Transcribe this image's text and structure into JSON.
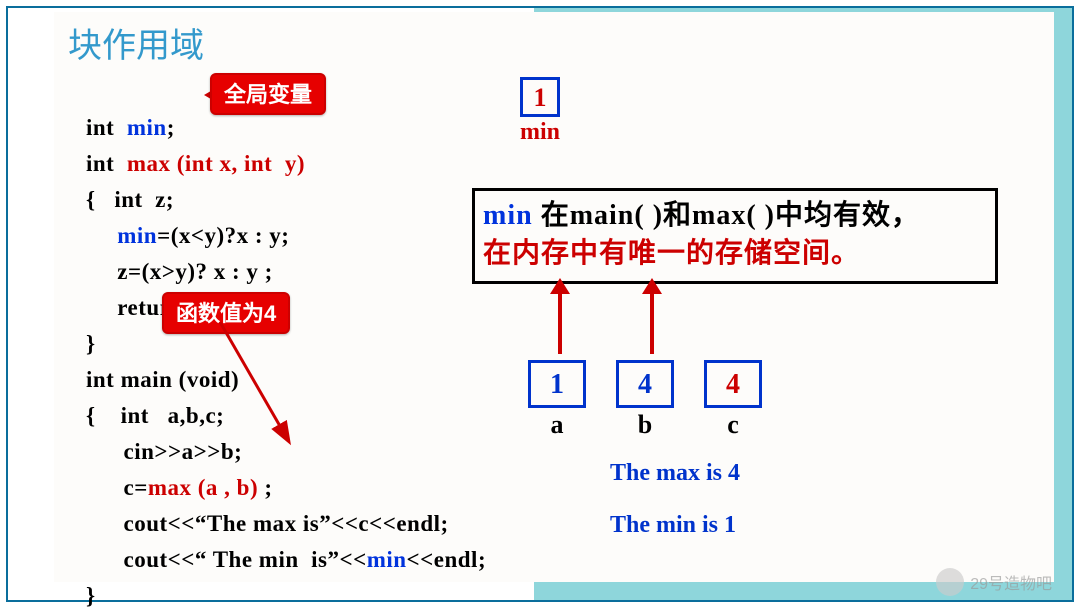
{
  "title": "块作用域",
  "callout1": "全局变量",
  "callout2": "函数值为4",
  "code": {
    "l1a": "int  ",
    "l1b": "min",
    "l1c": ";",
    "l2a": "int  ",
    "l2b": "max (int x, int  y)",
    "l3": "{   int  z;",
    "l4a": "     ",
    "l4b": "min",
    "l4c": "=(x<y)?x : y;",
    "l5": "     z=(x>y)? x : y ;",
    "l6": "     return  z;",
    "l7": "}",
    "l8": "int main (void)",
    "l9": "{    int   a,b,c;",
    "l10": "      cin>>a>>b;",
    "l11a": "      c=",
    "l11b": "max (a , b) ",
    "l11c": ";",
    "l12": "      cout<<“The max is”<<c<<endl;",
    "l13a": "      cout<<“ The min  is”<<",
    "l13b": "min",
    "l13c": "<<endl;",
    "l14": "}"
  },
  "box_min": {
    "value": "1",
    "label": "min"
  },
  "explain": {
    "line1_min": "min",
    "line1_rest": " 在main( )和max( )中均有效，",
    "line2": "在内存中有唯一的存储空间。"
  },
  "vars": {
    "a": {
      "value": "1",
      "label": "a"
    },
    "b": {
      "value": "4",
      "label": "b"
    },
    "c": {
      "value": "4",
      "label": "c"
    }
  },
  "output": {
    "line1": "The max is  4",
    "line2": "The min  is  1"
  },
  "watermark": "29号造物吧"
}
